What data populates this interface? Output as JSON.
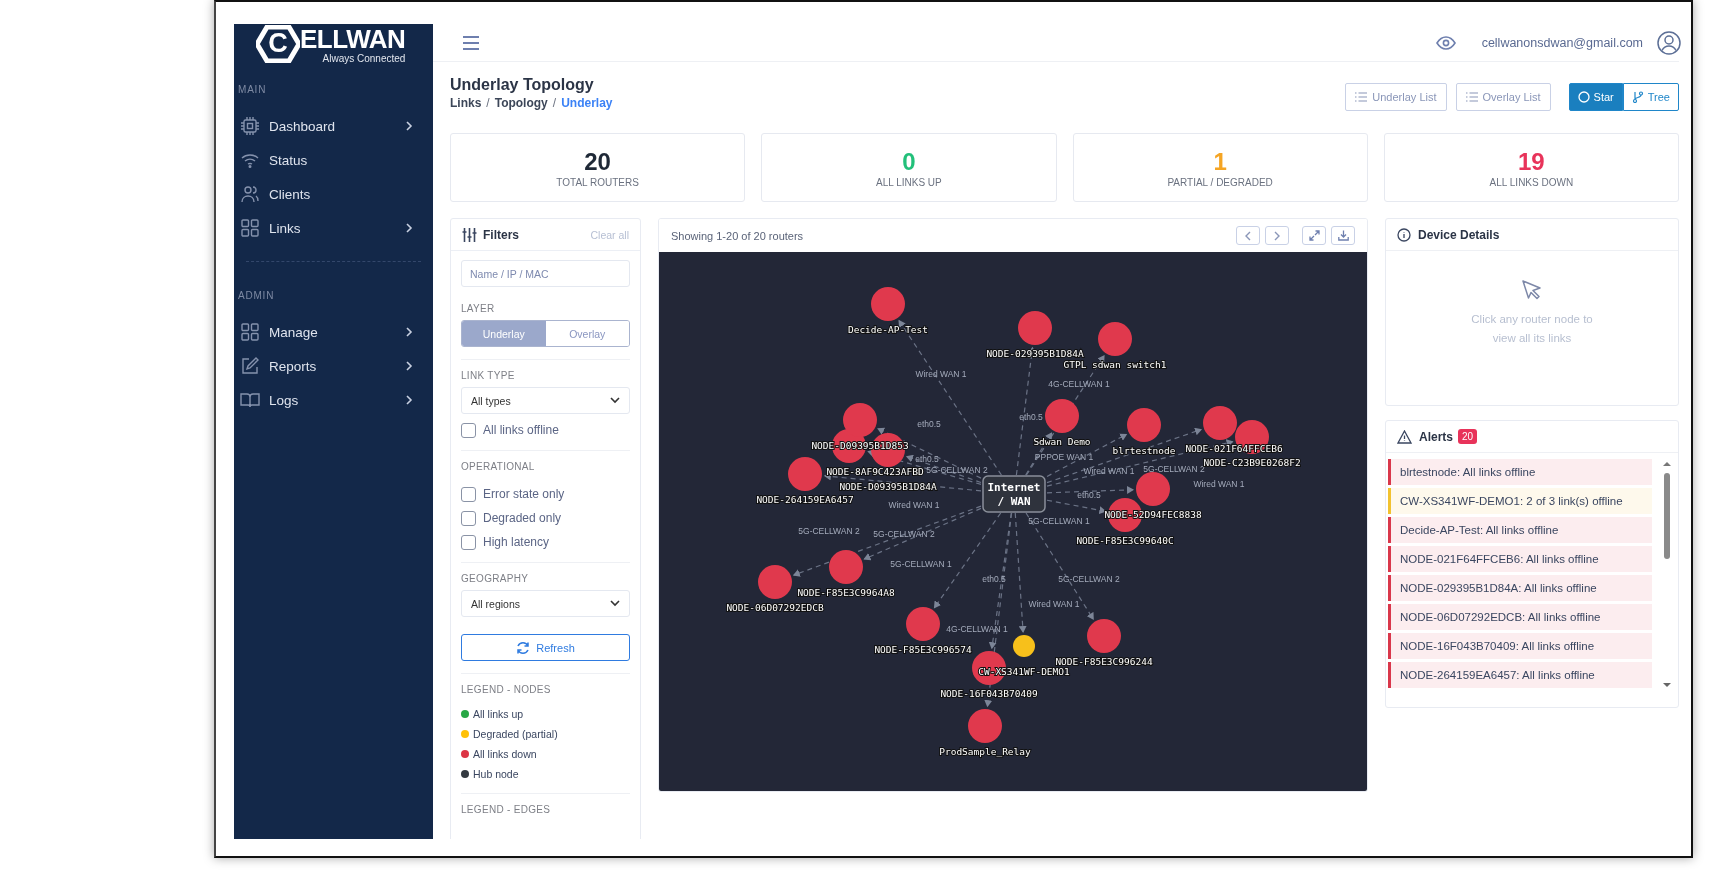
{
  "logo": {
    "mark": "C",
    "name": "ELLWAN",
    "tagline": "Always Connected"
  },
  "sidebar": {
    "sections": [
      {
        "title": "MAIN",
        "items": [
          {
            "label": "Dashboard",
            "has_submenu": true
          },
          {
            "label": "Status",
            "has_submenu": false
          },
          {
            "label": "Clients",
            "has_submenu": false
          },
          {
            "label": "Links",
            "has_submenu": true
          }
        ]
      },
      {
        "title": "ADMIN",
        "items": [
          {
            "label": "Manage",
            "has_submenu": true
          },
          {
            "label": "Reports",
            "has_submenu": true
          },
          {
            "label": "Logs",
            "has_submenu": true
          }
        ]
      }
    ]
  },
  "topbar": {
    "user": "cellwanonsdwan@gmail.com"
  },
  "page": {
    "title": "Underlay Topology",
    "separator": "/",
    "breadcrumb": [
      {
        "label": "Links",
        "current": false
      },
      {
        "label": "Topology",
        "current": false
      },
      {
        "label": "Underlay",
        "current": true
      }
    ]
  },
  "list_buttons": [
    "Underlay List",
    "Overlay List"
  ],
  "view_toggle": [
    {
      "label": "Star",
      "selected": true
    },
    {
      "label": "Tree",
      "selected": false
    }
  ],
  "stats": [
    {
      "value": "20",
      "label": "TOTAL ROUTERS",
      "color": "#1f2937"
    },
    {
      "value": "0",
      "label": "ALL LINKS UP",
      "color": "#22c07a"
    },
    {
      "value": "1",
      "label": "PARTIAL / DEGRADED",
      "color": "#f5a524"
    },
    {
      "value": "19",
      "label": "ALL LINKS DOWN",
      "color": "#e8335a"
    }
  ],
  "filters": {
    "title": "Filters",
    "clear": "Clear all",
    "search_placeholder": "Name / IP / MAC",
    "layer": {
      "label": "LAYER",
      "options": [
        {
          "label": "Underlay",
          "selected": true
        },
        {
          "label": "Overlay",
          "selected": false
        }
      ]
    },
    "link_type": {
      "label": "LINK TYPE",
      "value": "All types",
      "checkboxes": [
        {
          "label": "All links offline",
          "checked": false
        }
      ]
    },
    "operational": {
      "label": "OPERATIONAL",
      "checkboxes": [
        {
          "label": "Error state only",
          "checked": false
        },
        {
          "label": "Degraded only",
          "checked": false
        },
        {
          "label": "High latency",
          "checked": false
        }
      ]
    },
    "geography": {
      "label": "GEOGRAPHY",
      "value": "All regions"
    },
    "refresh": "Refresh",
    "legend_nodes": {
      "title": "LEGEND - NODES",
      "items": [
        {
          "label": "All links up",
          "color": "#28a745"
        },
        {
          "label": "Degraded (partial)",
          "color": "#ffc107"
        },
        {
          "label": "All links down",
          "color": "#dc3545"
        },
        {
          "label": "Hub node",
          "color": "#343a40"
        }
      ]
    },
    "legend_edges": {
      "title": "LEGEND - EDGES"
    }
  },
  "graph": {
    "summary": "Showing 1-20 of 20 routers",
    "hub": [
      "Internet",
      "/ WAN"
    ],
    "nodes": [
      {
        "name": "Decide-AP-Test",
        "color": "#e0394d",
        "link": "Wired WAN 1"
      },
      {
        "name": "NODE-029395B1D84A",
        "color": "#e0394d",
        "link": "eth0.5"
      },
      {
        "name": "GTPL sdwan switch1",
        "color": "#e0394d",
        "link": "4G-CELLWAN 1"
      },
      {
        "name": "Sdwan Demo",
        "color": "#e0394d",
        "link": "PPPOE WAN 1"
      },
      {
        "name": "blrtestnode",
        "color": "#e0394d",
        "link": "Wired WAN 1"
      },
      {
        "name": "NODE-021F64FFCEB6",
        "color": "#e0394d",
        "link": "5G-CELLWAN 2"
      },
      {
        "name": "NODE-C23B9E0268F2",
        "color": "#e0394d",
        "link": "Wired WAN 1"
      },
      {
        "name": "NODE-52D94FEC8838",
        "color": "#e0394d",
        "link": "eth0.5"
      },
      {
        "name": "NODE-F85E3C99640C",
        "color": "#e0394d",
        "link": "5G-CELLWAN 1"
      },
      {
        "name": "NODE-F85E3C996244",
        "color": "#e0394d",
        "link": "5G-CELLWAN 2"
      },
      {
        "name": "CW-XS341WF-DEMO1",
        "color": "#f7c01b",
        "link": "Wired WAN 1"
      },
      {
        "name": "NODE-16F043B70409",
        "color": "#e0394d",
        "link": "eth0.5"
      },
      {
        "name": "ProdSample_Relay",
        "color": "#e0394d",
        "link": "4G-CELLWAN 1"
      },
      {
        "name": "NODE-F85E3C9964A8",
        "color": "#e0394d",
        "link": "5G-CELLWAN 2"
      },
      {
        "name": "NODE-F85E3C996574",
        "color": "#e0394d",
        "link": "5G-CELLWAN 1"
      },
      {
        "name": "NODE-06D07292EDCB",
        "color": "#e0394d",
        "link": "5G-CELLWAN 2"
      },
      {
        "name": "NODE-8AF9C423AFBD",
        "color": "#e0394d",
        "link": "eth0.5"
      },
      {
        "name": "NODE-264159EA6457",
        "color": "#e0394d",
        "link": "eth0.5"
      },
      {
        "name": "NODE-D09395B1D853",
        "color": "#e0394d",
        "link": "5G-CELLWAN 2"
      },
      {
        "name": "NODE-D09395B1D84A",
        "color": "#e0394d",
        "link": "Wired WAN 1"
      }
    ]
  },
  "device_details": {
    "title": "Device Details",
    "hint": "Click any router node to view all its links"
  },
  "alerts": {
    "title": "Alerts",
    "count": "20",
    "items": [
      {
        "text": "blrtestnode: All links offline",
        "color": "#d9374b"
      },
      {
        "text": "CW-XS341WF-DEMO1: 2 of 3 link(s) offline",
        "color": "#f2c230"
      },
      {
        "text": "Decide-AP-Test: All links offline",
        "color": "#d9374b"
      },
      {
        "text": "NODE-021F64FFCEB6: All links offline",
        "color": "#d9374b"
      },
      {
        "text": "NODE-029395B1D84A: All links offline",
        "color": "#d9374b"
      },
      {
        "text": "NODE-06D07292EDCB: All links offline",
        "color": "#d9374b"
      },
      {
        "text": "NODE-16F043B70409: All links offline",
        "color": "#d9374b"
      },
      {
        "text": "NODE-264159EA6457: All links offline",
        "color": "#d9374b"
      }
    ]
  }
}
